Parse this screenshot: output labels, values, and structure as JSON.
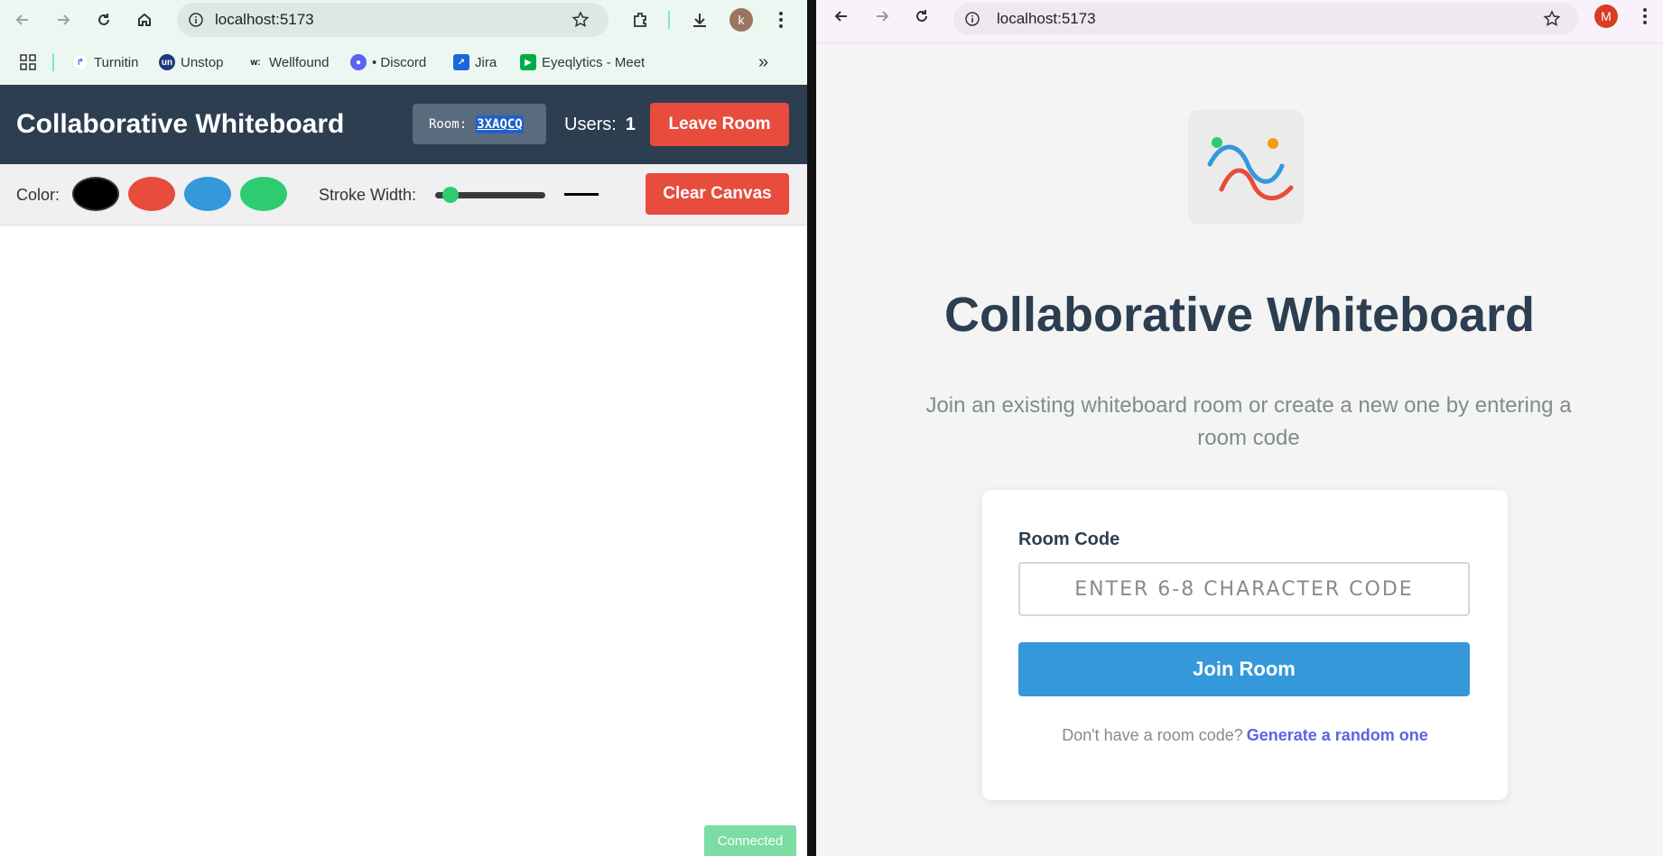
{
  "left_browser": {
    "url": "localhost:5173",
    "profile_initial": "k",
    "bookmarks": [
      {
        "label": "Turnitin",
        "icon": "turnitin-icon"
      },
      {
        "label": "Unstop",
        "icon": "unstop-icon"
      },
      {
        "label": "Wellfound",
        "icon": "wellfound-icon"
      },
      {
        "label": "• Discord",
        "icon": "discord-icon"
      },
      {
        "label": "Jira",
        "icon": "jira-icon"
      },
      {
        "label": "Eyeqlytics - Meet",
        "icon": "google-meet-icon"
      }
    ],
    "more_bookmarks": "»"
  },
  "whiteboard": {
    "title": "Collaborative Whiteboard",
    "room_label": "Room:",
    "room_code": "3XAQCQ",
    "users_label": "Users:",
    "users_count": "1",
    "leave_label": "Leave Room",
    "color_label": "Color:",
    "colors": [
      "#000000",
      "#e74c3c",
      "#3498db",
      "#2ecc71"
    ],
    "selected_color": "#000000",
    "stroke_label": "Stroke Width:",
    "stroke_width_fraction": 0.08,
    "clear_label": "Clear Canvas",
    "status": "Connected"
  },
  "right_browser": {
    "url": "localhost:5173",
    "profile_initial": "M"
  },
  "join": {
    "title": "Collaborative Whiteboard",
    "subtitle": "Join an existing whiteboard room or create a new one by entering a room code",
    "room_code_label": "Room Code",
    "room_code_placeholder": "ENTER 6-8 CHARACTER CODE",
    "join_label": "Join Room",
    "hint_text": "Don't have a room code?",
    "generate_label": "Generate a random one"
  },
  "theme": {
    "header_bg": "#2c3e50",
    "danger": "#e74c3c",
    "primary": "#3498db",
    "success": "#7bdca4",
    "link": "#5b63e6"
  }
}
